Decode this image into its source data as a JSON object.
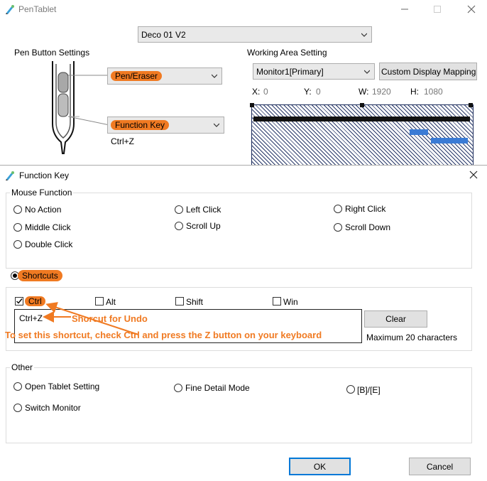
{
  "main_window": {
    "title": "PenTablet",
    "device_select": "Deco 01 V2",
    "pen_button_settings": {
      "label": "Pen Button Settings",
      "upper_button": "Pen/Eraser",
      "lower_button": "Function Key",
      "lower_value": "Ctrl+Z"
    },
    "working_area": {
      "label": "Working Area Setting",
      "monitor": "Monitor1[Primary]",
      "custom_mapping_button": "Custom Display Mapping",
      "x_label": "X:",
      "x_value": "0",
      "y_label": "Y:",
      "y_value": "0",
      "w_label": "W:",
      "w_value": "1920",
      "h_label": "H:",
      "h_value": "1080"
    }
  },
  "dialog": {
    "title": "Function Key",
    "mouse_function": {
      "label": "Mouse Function",
      "options": [
        "No Action",
        "Left Click",
        "Right Click",
        "Middle Click",
        "Scroll Up",
        "Scroll Down",
        "Double Click"
      ]
    },
    "shortcuts": {
      "label": "Shortcuts",
      "selected": true,
      "modifiers": [
        {
          "label": "Ctrl",
          "checked": true
        },
        {
          "label": "Alt",
          "checked": false
        },
        {
          "label": "Shift",
          "checked": false
        },
        {
          "label": "Win",
          "checked": false
        }
      ],
      "input_value": "Ctrl+Z",
      "clear_button": "Clear",
      "max_chars_note": "Maximum 20 characters"
    },
    "annotations": {
      "undo_note": "Shorcut for Undo",
      "instruction": "To set this shortcut, check Ctrl and press the Z button on your keyboard"
    },
    "other": {
      "label": "Other",
      "options": [
        "Open Tablet Setting",
        "Fine Detail Mode",
        "[B]/[E]",
        "Switch Monitor"
      ]
    },
    "ok_button": "OK",
    "cancel_button": "Cancel"
  },
  "colors": {
    "annotation_orange": "#f07a22",
    "button_face": "#e1e1e1",
    "ok_border": "#0078d7"
  }
}
